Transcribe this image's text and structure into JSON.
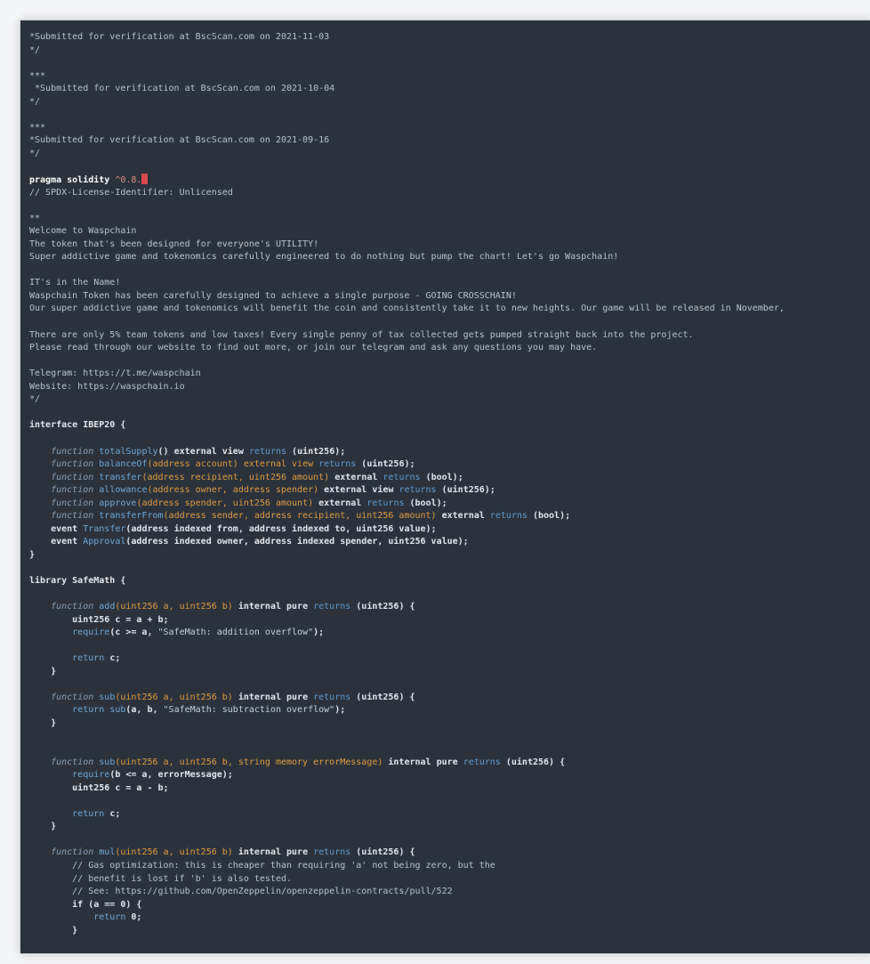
{
  "editor": {
    "lines": [
      [
        {
          "t": "*Submitted for verification at BscScan.com on 2021-11-03",
          "c": "comment"
        }
      ],
      [
        {
          "t": "*/",
          "c": "comment"
        }
      ],
      [],
      [
        {
          "t": "***",
          "c": "comment"
        }
      ],
      [
        {
          "t": " *Submitted for verification at BscScan.com on 2021-10-04",
          "c": "comment"
        }
      ],
      [
        {
          "t": "*/",
          "c": "comment"
        }
      ],
      [],
      [
        {
          "t": "***",
          "c": "comment"
        }
      ],
      [
        {
          "t": "*Submitted for verification at BscScan.com on 2021-09-16",
          "c": "comment"
        }
      ],
      [
        {
          "t": "*/",
          "c": "comment"
        }
      ],
      [],
      [
        {
          "t": "pragma solidity ",
          "c": "pragma"
        },
        {
          "t": "^0.8.",
          "c": "version"
        },
        {
          "t": "",
          "c": "cursor"
        }
      ],
      [
        {
          "t": "// SPDX-License-Identifier: Unlicensed",
          "c": "comment"
        }
      ],
      [],
      [
        {
          "t": "**",
          "c": "comment"
        }
      ],
      [
        {
          "t": "Welcome to Waspchain",
          "c": "comment"
        }
      ],
      [
        {
          "t": "The token that's been designed for everyone's UTILITY!",
          "c": "comment"
        }
      ],
      [
        {
          "t": "Super addictive game and tokenomics carefully engineered to do nothing but pump the chart! Let's go Waspchain!",
          "c": "comment"
        }
      ],
      [],
      [
        {
          "t": "IT's in the Name!",
          "c": "comment"
        }
      ],
      [
        {
          "t": "Waspchain Token has been carefully designed to achieve a single purpose - GOING CROSSCHAIN!",
          "c": "comment"
        }
      ],
      [
        {
          "t": "Our super addictive game and tokenomics will benefit the coin and consistently take it to new heights. Our game will be released in November,",
          "c": "comment"
        }
      ],
      [],
      [
        {
          "t": "There are only 5% team tokens and low taxes! Every single penny of tax collected gets pumped straight back into the project.",
          "c": "comment"
        }
      ],
      [
        {
          "t": "Please read through our website to find out more, or join our telegram and ask any questions you may have.",
          "c": "comment"
        }
      ],
      [],
      [
        {
          "t": "Telegram: https://t.me/waspchain",
          "c": "comment"
        }
      ],
      [
        {
          "t": "Website: https://waspchain.io",
          "c": "comment"
        }
      ],
      [
        {
          "t": "*/",
          "c": "comment"
        }
      ],
      [],
      [
        {
          "t": "interface IBEP20 {",
          "c": "plain"
        }
      ],
      [],
      [
        {
          "t": "    function ",
          "c": "kw"
        },
        {
          "t": "totalSupply",
          "c": "name"
        },
        {
          "t": "() external view ",
          "c": "plain"
        },
        {
          "t": "returns",
          "c": "ret"
        },
        {
          "t": " (uint256);",
          "c": "plain"
        }
      ],
      [
        {
          "t": "    function ",
          "c": "kw"
        },
        {
          "t": "balanceOf",
          "c": "name"
        },
        {
          "t": "(address account) external view ",
          "c": "param"
        },
        {
          "t": "returns",
          "c": "ret"
        },
        {
          "t": " (uint256);",
          "c": "plain"
        }
      ],
      [
        {
          "t": "    function ",
          "c": "kw"
        },
        {
          "t": "transfer",
          "c": "name"
        },
        {
          "t": "(address recipient, uint256 amount)",
          "c": "param"
        },
        {
          "t": " external ",
          "c": "plain"
        },
        {
          "t": "returns",
          "c": "ret"
        },
        {
          "t": " (bool);",
          "c": "plain"
        }
      ],
      [
        {
          "t": "    function ",
          "c": "kw"
        },
        {
          "t": "allowance",
          "c": "name"
        },
        {
          "t": "(address owner, address spender)",
          "c": "param"
        },
        {
          "t": " external view ",
          "c": "plain"
        },
        {
          "t": "returns",
          "c": "ret"
        },
        {
          "t": " (uint256);",
          "c": "plain"
        }
      ],
      [
        {
          "t": "    function ",
          "c": "kw"
        },
        {
          "t": "approve",
          "c": "name"
        },
        {
          "t": "(address spender, uint256 amount)",
          "c": "param"
        },
        {
          "t": " external ",
          "c": "plain"
        },
        {
          "t": "returns",
          "c": "ret"
        },
        {
          "t": " (bool);",
          "c": "plain"
        }
      ],
      [
        {
          "t": "    function ",
          "c": "kw"
        },
        {
          "t": "transferFrom",
          "c": "name"
        },
        {
          "t": "(address sender, address recipient, uint256 amount)",
          "c": "param"
        },
        {
          "t": " external ",
          "c": "plain"
        },
        {
          "t": "returns",
          "c": "ret"
        },
        {
          "t": " (bool);",
          "c": "plain"
        }
      ],
      [
        {
          "t": "    event ",
          "c": "plain"
        },
        {
          "t": "Transfer",
          "c": "name"
        },
        {
          "t": "(address indexed from, address indexed to, uint256 value);",
          "c": "plain"
        }
      ],
      [
        {
          "t": "    event ",
          "c": "plain"
        },
        {
          "t": "Approval",
          "c": "name"
        },
        {
          "t": "(address indexed owner, address indexed spender, uint256 value);",
          "c": "plain"
        }
      ],
      [
        {
          "t": "}",
          "c": "plain"
        }
      ],
      [],
      [
        {
          "t": "library SafeMath {",
          "c": "plain"
        }
      ],
      [],
      [
        {
          "t": "    function ",
          "c": "kw"
        },
        {
          "t": "add",
          "c": "name"
        },
        {
          "t": "(uint256 a, uint256 b)",
          "c": "param"
        },
        {
          "t": " internal pure ",
          "c": "plain"
        },
        {
          "t": "returns",
          "c": "ret"
        },
        {
          "t": " (uint256) {",
          "c": "plain"
        }
      ],
      [
        {
          "t": "        uint256 c = a + b;",
          "c": "plain"
        }
      ],
      [
        {
          "t": "        require",
          "c": "name"
        },
        {
          "t": "(c >= a, ",
          "c": "plain"
        },
        {
          "t": "\"SafeMath: addition overflow\"",
          "c": "string"
        },
        {
          "t": ");",
          "c": "plain"
        }
      ],
      [],
      [
        {
          "t": "        return",
          "c": "name"
        },
        {
          "t": " c;",
          "c": "plain"
        }
      ],
      [
        {
          "t": "    }",
          "c": "plain"
        }
      ],
      [],
      [
        {
          "t": "    function ",
          "c": "kw"
        },
        {
          "t": "sub",
          "c": "name"
        },
        {
          "t": "(uint256 a, uint256 b)",
          "c": "param"
        },
        {
          "t": " internal pure ",
          "c": "plain"
        },
        {
          "t": "returns",
          "c": "ret"
        },
        {
          "t": " (uint256) {",
          "c": "plain"
        }
      ],
      [
        {
          "t": "        return ",
          "c": "name"
        },
        {
          "t": "sub",
          "c": "name"
        },
        {
          "t": "(a, b, ",
          "c": "plain"
        },
        {
          "t": "\"SafeMath: subtraction overflow\"",
          "c": "string"
        },
        {
          "t": ");",
          "c": "plain"
        }
      ],
      [
        {
          "t": "    }",
          "c": "plain"
        }
      ],
      [],
      [],
      [
        {
          "t": "    function ",
          "c": "kw"
        },
        {
          "t": "sub",
          "c": "name"
        },
        {
          "t": "(uint256 a, uint256 b, string memory errorMessage)",
          "c": "param"
        },
        {
          "t": " internal pure ",
          "c": "plain"
        },
        {
          "t": "returns",
          "c": "ret"
        },
        {
          "t": " (uint256) {",
          "c": "plain"
        }
      ],
      [
        {
          "t": "        require",
          "c": "name"
        },
        {
          "t": "(b <= a, errorMessage);",
          "c": "plain"
        }
      ],
      [
        {
          "t": "        uint256 c = a - b;",
          "c": "plain"
        }
      ],
      [],
      [
        {
          "t": "        return",
          "c": "name"
        },
        {
          "t": " c;",
          "c": "plain"
        }
      ],
      [
        {
          "t": "    }",
          "c": "plain"
        }
      ],
      [],
      [
        {
          "t": "    function ",
          "c": "kw"
        },
        {
          "t": "mul",
          "c": "name"
        },
        {
          "t": "(uint256 a, uint256 b)",
          "c": "param"
        },
        {
          "t": " internal pure ",
          "c": "plain"
        },
        {
          "t": "returns",
          "c": "ret"
        },
        {
          "t": " (uint256) {",
          "c": "plain"
        }
      ],
      [
        {
          "t": "        // Gas optimization: this is cheaper than requiring 'a' not being zero, but the",
          "c": "comment"
        }
      ],
      [
        {
          "t": "        // benefit is lost if 'b' is also tested.",
          "c": "comment"
        }
      ],
      [
        {
          "t": "        // See: https://github.com/OpenZeppelin/openzeppelin-contracts/pull/522",
          "c": "comment"
        }
      ],
      [
        {
          "t": "        if (a == 0) {",
          "c": "plain"
        }
      ],
      [
        {
          "t": "            return ",
          "c": "name"
        },
        {
          "t": "0;",
          "c": "plain"
        }
      ],
      [
        {
          "t": "        }",
          "c": "plain"
        }
      ]
    ]
  }
}
